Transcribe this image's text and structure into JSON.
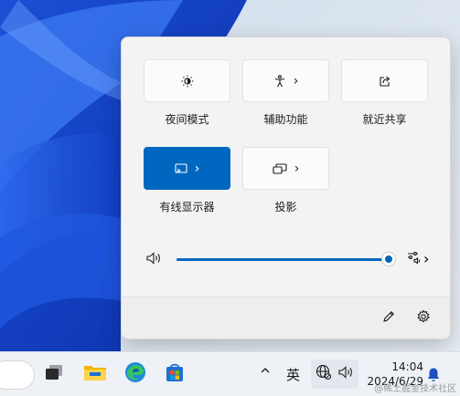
{
  "quick_settings": {
    "tiles": [
      {
        "icon": "brightness-moon-icon",
        "label": "夜间模式",
        "active": false,
        "has_chevron": false
      },
      {
        "icon": "accessibility-icon",
        "label": "辅助功能",
        "active": false,
        "has_chevron": true
      },
      {
        "icon": "share-icon",
        "label": "就近共享",
        "active": false,
        "has_chevron": false
      },
      {
        "icon": "cast-icon",
        "label": "有线显示器",
        "active": true,
        "has_chevron": true
      },
      {
        "icon": "project-icon",
        "label": "投影",
        "active": false,
        "has_chevron": true
      }
    ],
    "chevron": "›",
    "volume": {
      "icon": "speaker-icon",
      "level": 1.0
    },
    "footer": {
      "edit_icon": "pencil-icon",
      "settings_icon": "gear-icon"
    }
  },
  "taskbar": {
    "apps": [
      "task-view-icon",
      "file-explorer-icon",
      "edge-icon",
      "store-icon"
    ],
    "tray_chevron": "^",
    "ime_label": "英",
    "time": "14:04",
    "date": "2024/6/29",
    "watermark": "@稀土掘金技术社区"
  },
  "colors": {
    "accent": "#0067c0",
    "flyout_bg": "#f3f3f3",
    "taskbar_bg": "#eef1f6"
  }
}
